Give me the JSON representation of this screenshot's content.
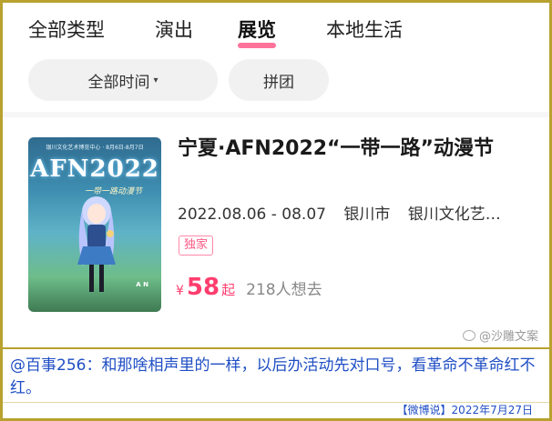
{
  "tabs": [
    {
      "label": "全部类型"
    },
    {
      "label": "演出"
    },
    {
      "label": "展览"
    },
    {
      "label": "本地生活"
    }
  ],
  "filters": {
    "time_label": "全部时间",
    "group_label": "拼团"
  },
  "event": {
    "title": "宁夏·AFN2022“一带一路”动漫节",
    "date": "2022.08.06 - 08.07",
    "city": "银川市",
    "venue": "银川文化艺…",
    "badge": "独家",
    "currency": "¥",
    "price": "58",
    "price_suffix": "起",
    "want": "218人想去",
    "poster": {
      "top_text": "银川文化艺术博览中心 · 8月6日-8月7日",
      "logo": "AFN2022",
      "sub": "一带一路动漫节",
      "corner": "A N"
    }
  },
  "watermark": "@沙雕文案",
  "caption": {
    "text": "@百事256：和那啥相声里的一样，以后办活动先对口号，看革命不革命红不红。",
    "footer": "【微博说】2022年7月27日"
  },
  "colors": {
    "accent": "#ff3d6e",
    "caption_text": "#1f4ec4",
    "frame": "#b8a12e"
  }
}
